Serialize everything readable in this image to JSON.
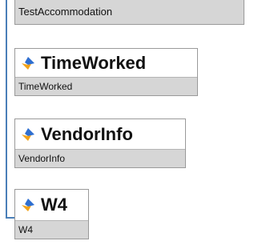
{
  "colors": {
    "connector": "#4a7fb8",
    "node_border": "#9a9a9a",
    "node_body": "#d6d6d6",
    "icon_blue": "#2f6fd0",
    "icon_orange": "#f2a31a"
  },
  "nodes": [
    {
      "title": "",
      "subtitle": "TestAccommodation",
      "icon": "entity-icon"
    },
    {
      "title": "TimeWorked",
      "subtitle": "TimeWorked",
      "icon": "entity-icon"
    },
    {
      "title": "VendorInfo",
      "subtitle": "VendorInfo",
      "icon": "entity-icon"
    },
    {
      "title": "W4",
      "subtitle": "W4",
      "icon": "entity-icon"
    }
  ]
}
